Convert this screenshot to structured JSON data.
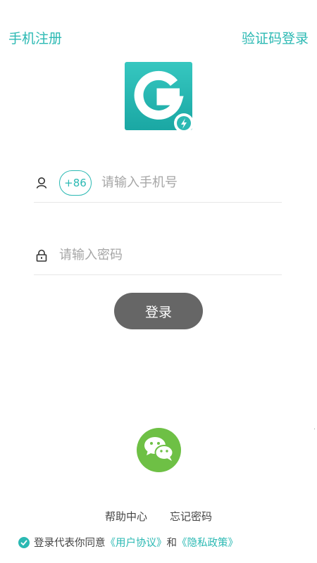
{
  "header": {
    "phone_register": "手机注册",
    "code_login": "验证码登录"
  },
  "logo": {
    "icon": "app-logo-g-icon",
    "color": "#2bb9b3"
  },
  "phone_field": {
    "country_code": "+86",
    "placeholder": "请输入手机号",
    "icon": "user-icon"
  },
  "password_field": {
    "placeholder": "请输入密码",
    "icon": "lock-icon"
  },
  "login_button": {
    "label": "登录",
    "color": "#666666"
  },
  "wechat": {
    "icon": "wechat-icon",
    "color": "#6ec045"
  },
  "bottom_links": {
    "help": "帮助中心",
    "forgot": "忘记密码"
  },
  "agreement": {
    "prefix": "登录代表你同意",
    "user_agreement": "《用户协议》",
    "and": "和",
    "privacy_policy": "《隐私政策》"
  },
  "accent_color": "#2bb9b3"
}
